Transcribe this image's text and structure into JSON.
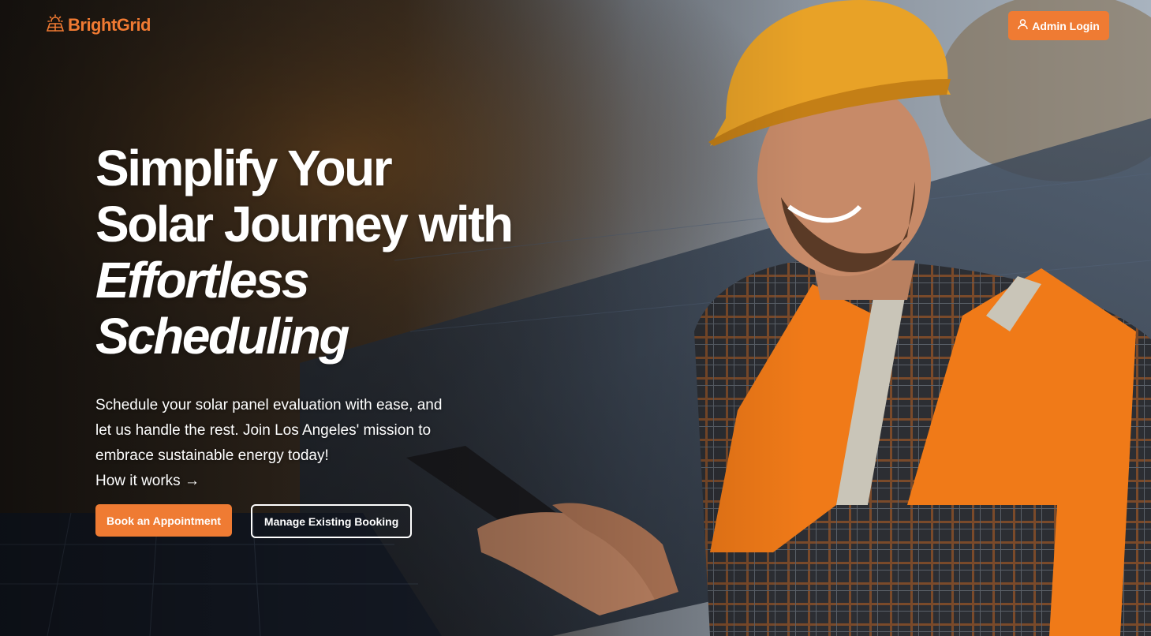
{
  "brand": {
    "name": "BrightGrid",
    "logo_icon": "sun-grid-icon",
    "color": "#f07a32"
  },
  "header": {
    "admin_login_label": "Admin Login",
    "admin_icon": "user-icon"
  },
  "hero": {
    "headline_line1": "Simplify Your",
    "headline_line2": "Solar Journey with",
    "headline_italic1": "Effortless",
    "headline_italic2": "Scheduling",
    "description": "Schedule your solar panel evaluation with ease, and let us handle the rest. Join Los Angeles' mission to embrace sustainable energy today!",
    "how_it_works_label": "How it works →",
    "background_image": "solar-worker-photo"
  },
  "actions": {
    "book_label": "Book an Appointment",
    "manage_label": "Manage Existing Booking"
  },
  "colors": {
    "accent": "#ef7b33",
    "text": "#ffffff"
  }
}
